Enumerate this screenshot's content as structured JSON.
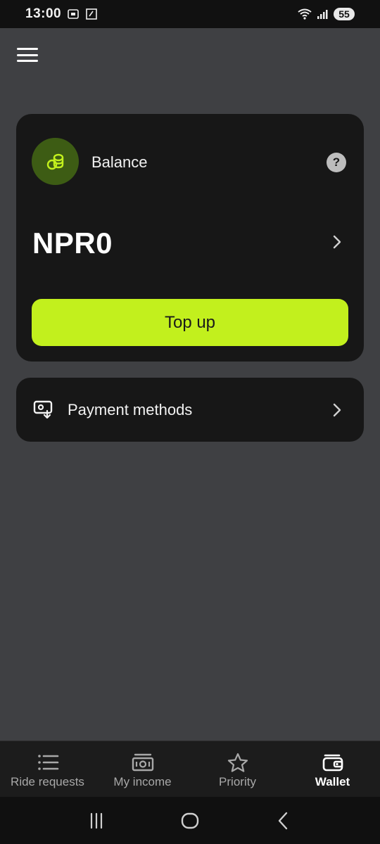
{
  "status_bar": {
    "time": "13:00",
    "battery": "55"
  },
  "balance": {
    "label": "Balance",
    "help_symbol": "?",
    "amount": "NPR0",
    "topup_label": "Top up"
  },
  "payment": {
    "label": "Payment methods"
  },
  "nav": {
    "items": [
      {
        "label": "Ride requests",
        "icon": "list-icon"
      },
      {
        "label": "My income",
        "icon": "money-icon"
      },
      {
        "label": "Priority",
        "icon": "star-icon"
      },
      {
        "label": "Wallet",
        "icon": "wallet-icon",
        "active": true
      }
    ]
  },
  "colors": {
    "accent": "#c2f01d",
    "card": "#171717",
    "background": "#3f4043",
    "coin_bg": "#3d5c14"
  }
}
